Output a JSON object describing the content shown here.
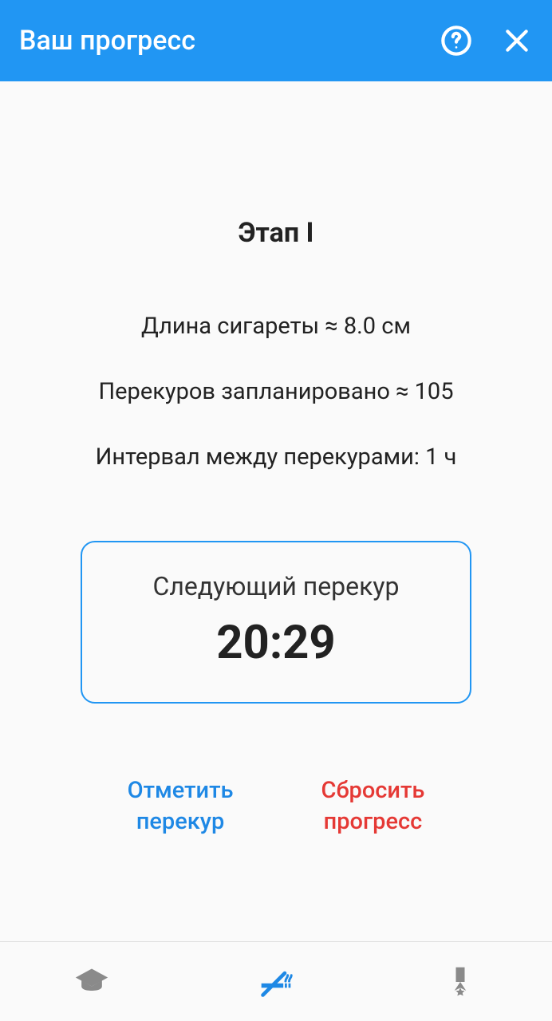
{
  "header": {
    "title": "Ваш прогресс"
  },
  "main": {
    "stage_title": "Этап I",
    "cig_length_line": "Длина сигареты  ≈  8.0 см",
    "breaks_planned_line": "Перекуров запланировано  ≈  105",
    "interval_line": "Интервал между перекурами: 1 ч",
    "next_label": "Следующий перекур",
    "next_time": "20:29"
  },
  "actions": {
    "mark": "Отметить перекур",
    "reset": "Сбросить прогресс"
  }
}
